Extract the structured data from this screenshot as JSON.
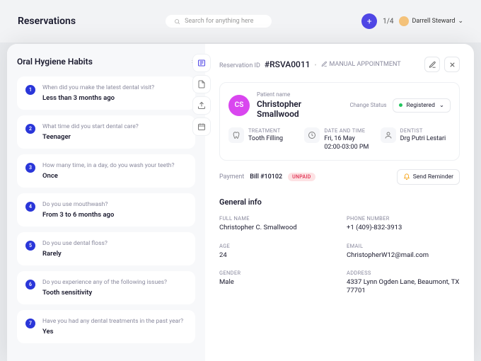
{
  "bg": {
    "title": "Reservations",
    "search_placeholder": "Search for anything here",
    "fraction": "1/4",
    "user": "Darrell Steward"
  },
  "left": {
    "title": "Oral Hygiene Habits",
    "questions": [
      {
        "q": "When did you make the latest dental visit?",
        "a": "Less than 3 months ago"
      },
      {
        "q": "What time did you start dental care?",
        "a": "Teenager"
      },
      {
        "q": "How many time, in a day, do you wash your teeth?",
        "a": "Once"
      },
      {
        "q": "Do you use mouthwash?",
        "a": "From 3 to 6 months ago"
      },
      {
        "q": "Do you use dental floss?",
        "a": "Rarely"
      },
      {
        "q": "Do you experience any of the following issues?",
        "a": "Tooth sensitivity"
      },
      {
        "q": "Have you had any dental treatments in the past year?",
        "a": "Yes"
      }
    ]
  },
  "resv": {
    "id_label": "Reservation ID",
    "id": "#RSVA0011",
    "manual": "MANUAL APPOINTMENT"
  },
  "patient": {
    "label": "Patient name",
    "name": "Christopher Smallwood",
    "initials": "CS",
    "change_status": "Change Status",
    "status": "Registered"
  },
  "meta": {
    "treatment_label": "TREATMENT",
    "treatment": "Tooth Filling",
    "datetime_label": "DATE AND TIME",
    "date": "Fri, 16 May",
    "time": "02:00-03:00 PM",
    "dentist_label": "DENTIST",
    "dentist": "Drg Putri Lestari"
  },
  "payment": {
    "label": "Payment",
    "bill": "Bill #10102",
    "status": "UNPAID",
    "send": "Send Reminder"
  },
  "gi": {
    "title": "General info",
    "fullname_label": "FULL NAME",
    "fullname": "Christopher C. Smallwood",
    "phone_label": "PHONE NUMBER",
    "phone": "+1 (409)-832-3913",
    "age_label": "AGE",
    "age": "24",
    "email_label": "EMAIL",
    "email": "ChristopherW12@mail.com",
    "gender_label": "GENDER",
    "gender": "Male",
    "address_label": "ADDRESS",
    "address": "4337 Lynn Ogden Lane, Beaumont, TX 77701"
  }
}
